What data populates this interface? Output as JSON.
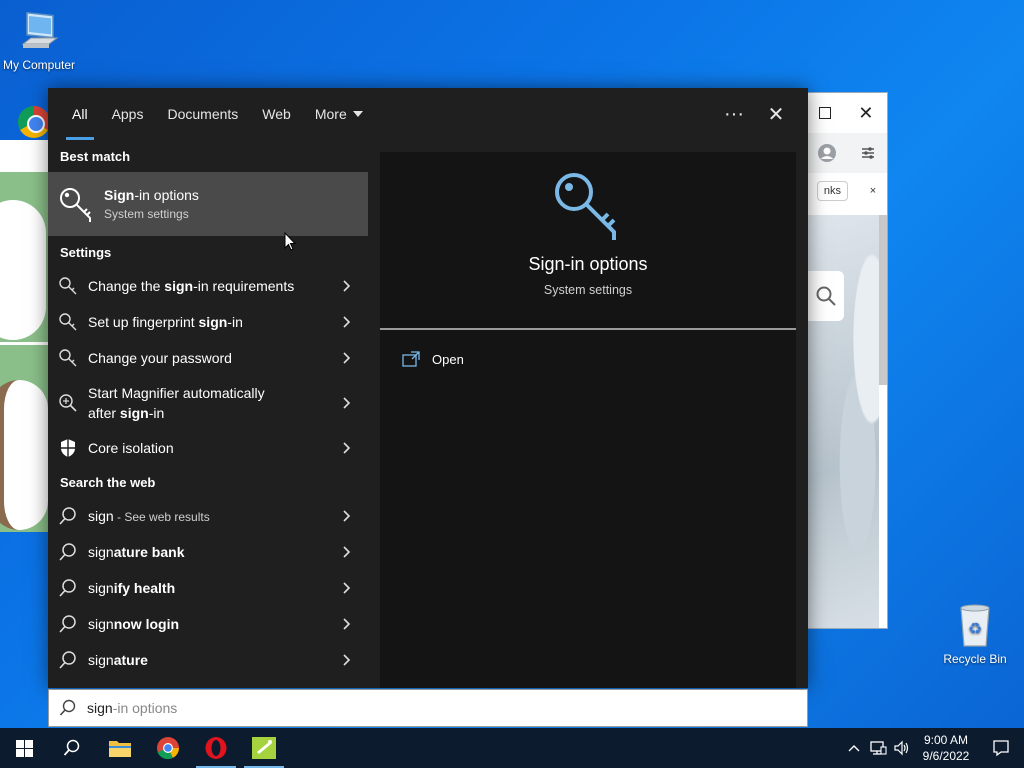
{
  "desktop": {
    "my_computer_label": "My Computer",
    "recycle_bin_label": "Recycle Bin"
  },
  "bg_window": {
    "tab_text": "nks",
    "tab_close": "×"
  },
  "search": {
    "tabs": [
      {
        "label": "All",
        "active": true
      },
      {
        "label": "Apps"
      },
      {
        "label": "Documents"
      },
      {
        "label": "Web"
      },
      {
        "label": "More"
      }
    ],
    "more_options": "···",
    "close_glyph": "✕",
    "best_match_heading": "Best match",
    "best_match": {
      "title_bold": "Sign",
      "title_rest": "-in options",
      "subtitle": "System settings"
    },
    "settings_heading": "Settings",
    "settings_items": [
      {
        "pre": "Change the ",
        "bold": "sign",
        "post": "-in requirements"
      },
      {
        "pre": "Set up fingerprint ",
        "bold": "sign",
        "post": "-in"
      },
      {
        "pre": "Change your password",
        "bold": "",
        "post": ""
      },
      {
        "pre": "Start Magnifier automatically",
        "line2_pre": "after ",
        "bold": "sign",
        "post": "-in"
      },
      {
        "pre": "Core isolation",
        "bold": "",
        "post": ""
      }
    ],
    "web_heading": "Search the web",
    "web_items": [
      {
        "pre": "sign",
        "bold": "",
        "post": "",
        "dim": " - See web results"
      },
      {
        "pre": "sign",
        "bold": "ature bank",
        "post": ""
      },
      {
        "pre": "sign",
        "bold": "ify health",
        "post": ""
      },
      {
        "pre": "sign",
        "bold": "now login",
        "post": ""
      },
      {
        "pre": "sign",
        "bold": "ature",
        "post": ""
      }
    ],
    "preview": {
      "title": "Sign-in options",
      "subtitle": "System settings",
      "action": "Open"
    },
    "query_typed": "sign",
    "query_ghost": "-in options"
  },
  "taskbar": {
    "time": "9:00 AM",
    "date": "9/6/2022"
  },
  "colors": {
    "accent": "#4aa0e6",
    "panel_bg": "#1f1f1f",
    "preview_bg": "#141414",
    "key_icon": "#7ab8e6",
    "taskbar_bg": "#0c1b2e"
  }
}
